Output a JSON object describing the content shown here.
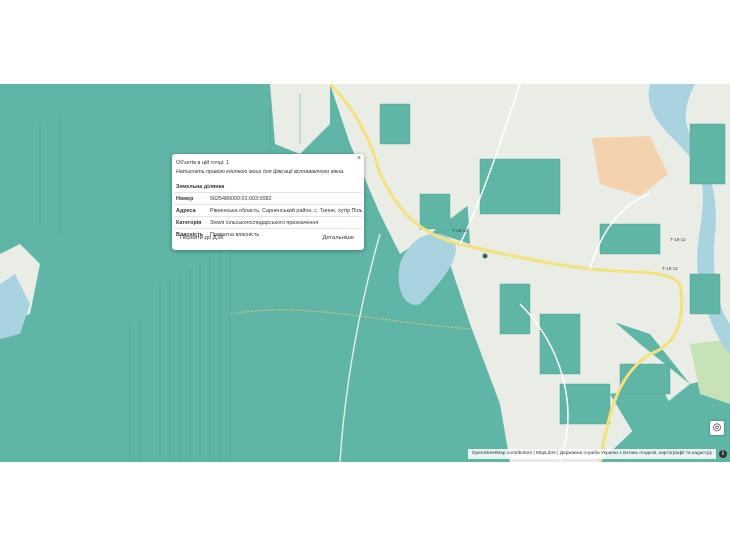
{
  "popup": {
    "count_text": "Об'єктів в цій точці: 1",
    "hint_text": "Натисніть правою кнопкою миші для фіксації всплаваючого вікна.",
    "close_symbol": "×",
    "parcel_title": "Земельна ділянка",
    "rows": [
      {
        "key": "Номер",
        "value": "5625480000:01:003:0082"
      },
      {
        "key": "Адреса",
        "value": "Рівненська область, Сарненський район, с. Тинне, хутір Піль"
      },
      {
        "key": "Категорія",
        "value": "Землі сільськогосподарського призначення"
      },
      {
        "key": "Власність",
        "value": "Приватна власність"
      }
    ],
    "goto_button": "Перейти до ДЗК",
    "details_button": "Детальніше"
  },
  "map": {
    "road_labels": [
      "Т-18-12",
      "Т-18-12",
      "Т-18-12"
    ],
    "colors": {
      "parcel": "#5fb6a6",
      "field": "#e9ede6",
      "road": "#f6e27a",
      "water": "#a9d3df",
      "urban": "#f3d2ad",
      "green": "#c6e3b8"
    }
  },
  "attribution": {
    "osm": "OpenStreetMap contributors",
    "rest": " | MapLibre | Державна служба України з питань геодезії, картографії та кадастру",
    "info_symbol": "i"
  },
  "controls": {
    "locate_symbol": "◎"
  }
}
